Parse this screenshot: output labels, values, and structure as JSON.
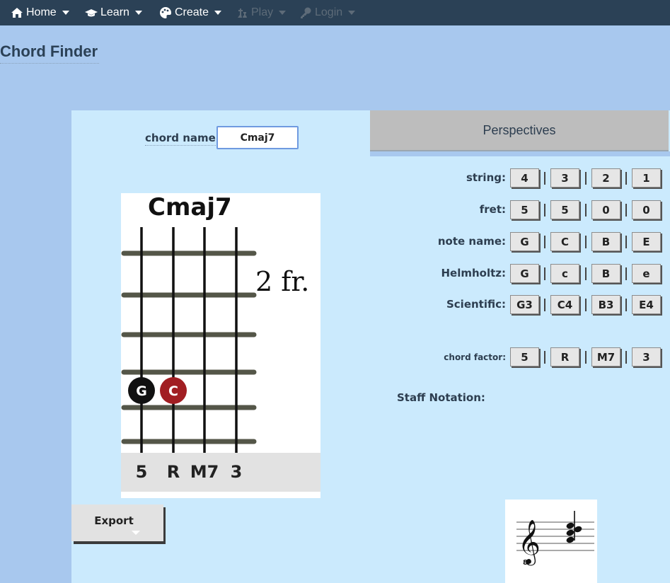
{
  "nav": {
    "items": [
      {
        "label": "Home",
        "icon": "home-icon"
      },
      {
        "label": "Learn",
        "icon": "graduation-cap-icon"
      },
      {
        "label": "Create",
        "icon": "palette-icon"
      },
      {
        "label": "Play",
        "icon": "chess-icon",
        "disabled": true
      },
      {
        "label": "Login",
        "icon": "key-icon",
        "disabled": true
      }
    ]
  },
  "page_title": "Chord Finder",
  "chord_input": {
    "label": "chord name:",
    "value": "Cmaj7"
  },
  "diagram": {
    "title": "Cmaj7",
    "fret_position": "2 fr.",
    "strings_shown": 4,
    "frets_shown": 6,
    "dots": [
      {
        "string_index": 0,
        "label": "G",
        "color": "#111111"
      },
      {
        "string_index": 1,
        "label": "C",
        "color": "#a11e22"
      }
    ],
    "factors": [
      "5",
      "R",
      "M7",
      "3"
    ]
  },
  "export_button": {
    "label": "Export"
  },
  "perspectives": {
    "title": "Perspectives",
    "rows": [
      {
        "label": "string:",
        "values": [
          "4",
          "3",
          "2",
          "1"
        ]
      },
      {
        "label": "fret:",
        "values": [
          "5",
          "5",
          "0",
          "0"
        ]
      },
      {
        "label": "note name:",
        "values": [
          "G",
          "C",
          "B",
          "E"
        ]
      },
      {
        "label": "Helmholtz:",
        "values": [
          "G",
          "c",
          "B",
          "e"
        ]
      },
      {
        "label": "Scientific:",
        "values": [
          "G3",
          "C4",
          "B3",
          "E4"
        ]
      },
      {
        "label": "chord factor:",
        "values": [
          "5",
          "R",
          "M7",
          "3"
        ]
      }
    ]
  },
  "staff": {
    "label": "Staff Notation:"
  },
  "colors": {
    "navbar": "#2b4156",
    "page_bg": "#a8c8ee",
    "panel_bg": "#cbeafd",
    "dot_root": "#a11e22",
    "dot_other": "#111111"
  }
}
